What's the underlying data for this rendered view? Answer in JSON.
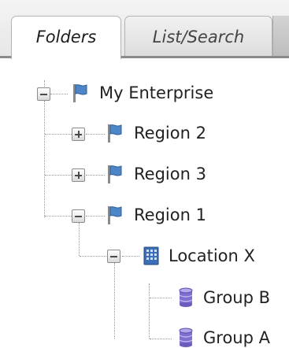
{
  "tabs": [
    {
      "label": "Folders",
      "active": true
    },
    {
      "label": "List/Search",
      "active": false
    }
  ],
  "tree": {
    "root": {
      "label": "My Enterprise",
      "icon": "flag-icon",
      "expanded": true
    },
    "region2": {
      "label": "Region 2",
      "icon": "flag-icon",
      "expanded": false
    },
    "region3": {
      "label": "Region 3",
      "icon": "flag-icon",
      "expanded": false
    },
    "region1": {
      "label": "Region 1",
      "icon": "flag-icon",
      "expanded": true
    },
    "location_x": {
      "label": "Location X",
      "icon": "building-icon",
      "expanded": true
    },
    "group_b": {
      "label": "Group B",
      "icon": "database-icon"
    },
    "group_a": {
      "label": "Group A",
      "icon": "database-icon"
    }
  },
  "colors": {
    "flag_blue": "#4d86c7",
    "building_blue": "#3d6fb8",
    "database_purple": "#7f6fd0",
    "tab_border": "#b3b3b3"
  }
}
